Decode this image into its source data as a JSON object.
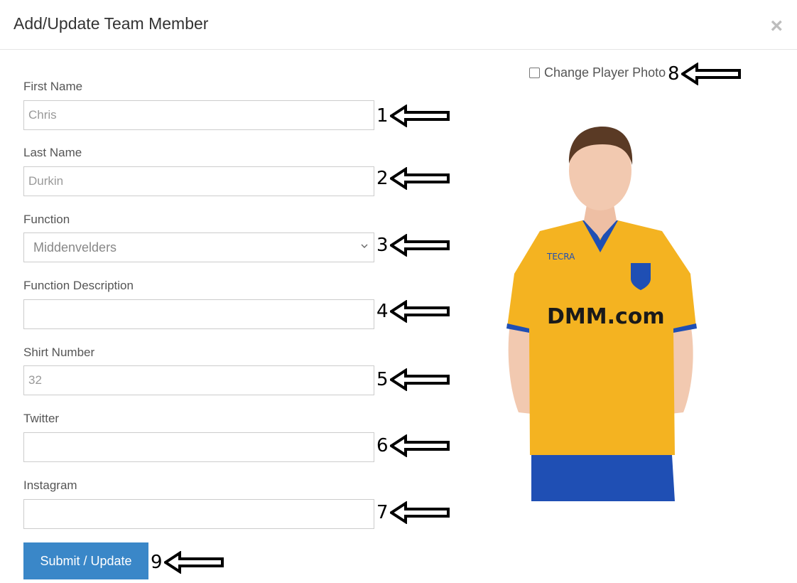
{
  "modal": {
    "title": "Add/Update Team Member",
    "close_glyph": "×"
  },
  "form": {
    "first_name": {
      "label": "First Name",
      "value": "Chris"
    },
    "last_name": {
      "label": "Last Name",
      "value": "Durkin"
    },
    "function": {
      "label": "Function",
      "selected": "Middenvelders"
    },
    "function_description": {
      "label": "Function Description",
      "value": ""
    },
    "shirt_number": {
      "label": "Shirt Number",
      "value": "32"
    },
    "twitter": {
      "label": "Twitter",
      "value": ""
    },
    "instagram": {
      "label": "Instagram",
      "value": ""
    },
    "submit_label": "Submit / Update"
  },
  "photo": {
    "change_label": "Change Player Photo",
    "checked": false,
    "jersey_sponsor": "DMM.com",
    "jersey_brand": "TECRA",
    "jersey_color": "#f4b321",
    "shorts_color": "#1f4fb4"
  },
  "annotations": [
    "1",
    "2",
    "3",
    "4",
    "5",
    "6",
    "7",
    "8",
    "9"
  ]
}
